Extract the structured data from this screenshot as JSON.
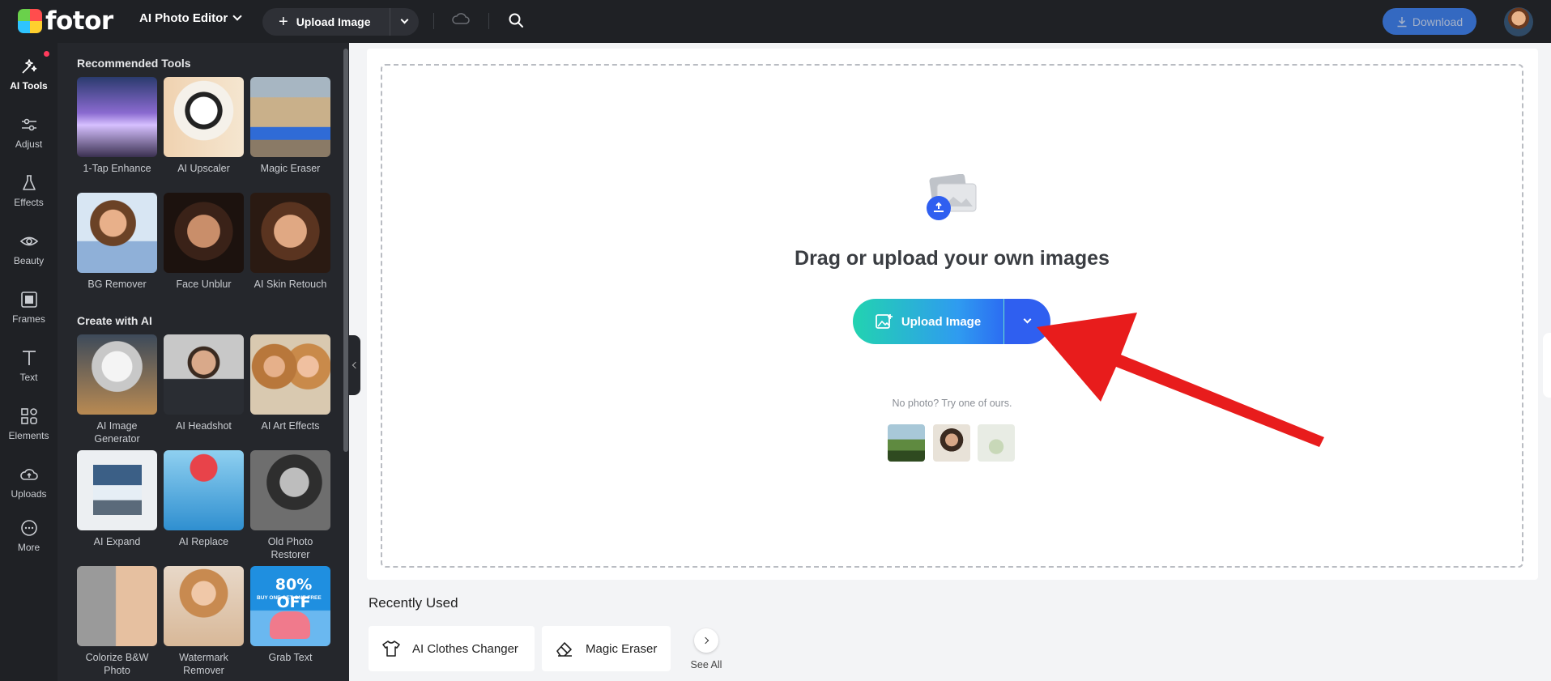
{
  "topbar": {
    "logo_text": "fotor",
    "editor_select": "AI Photo Editor",
    "upload_label": "Upload Image",
    "download_label": "Download"
  },
  "rail": {
    "items": [
      {
        "label": "AI Tools",
        "icon": "sparkle-icon"
      },
      {
        "label": "Adjust",
        "icon": "sliders-icon"
      },
      {
        "label": "Effects",
        "icon": "flask-icon"
      },
      {
        "label": "Beauty",
        "icon": "eye-icon"
      },
      {
        "label": "Frames",
        "icon": "frame-icon"
      },
      {
        "label": "Text",
        "icon": "text-icon"
      },
      {
        "label": "Elements",
        "icon": "shapes-icon"
      },
      {
        "label": "Uploads",
        "icon": "cloud-upload-icon"
      },
      {
        "label": "More",
        "icon": "more-icon"
      }
    ]
  },
  "panel": {
    "recommended_title": "Recommended Tools",
    "create_title": "Create with AI",
    "recommended": [
      {
        "label": "1-Tap Enhance"
      },
      {
        "label": "AI Upscaler"
      },
      {
        "label": "Magic Eraser"
      },
      {
        "label": "BG Remover"
      },
      {
        "label": "Face Unblur"
      },
      {
        "label": "AI Skin Retouch"
      }
    ],
    "create": [
      {
        "label": "AI Image Generator"
      },
      {
        "label": "AI Headshot"
      },
      {
        "label": "AI Art Effects"
      },
      {
        "label": "AI Expand"
      },
      {
        "label": "AI Replace"
      },
      {
        "label": "Old Photo Restorer"
      },
      {
        "label": "Colorize B&W Photo"
      },
      {
        "label": "Watermark Remover"
      },
      {
        "label": "Grab Text"
      }
    ],
    "promo_text": "80% OFF",
    "promo_sub": "BUY ONE GET ONE FREE"
  },
  "canvas": {
    "title": "Drag or upload your own images",
    "upload_label": "Upload Image",
    "no_photo": "No photo? Try one of ours."
  },
  "recent": {
    "title": "Recently Used",
    "items": [
      {
        "label": "AI Clothes Changer",
        "icon": "shirt-icon"
      },
      {
        "label": "Magic Eraser",
        "icon": "eraser-icon"
      }
    ],
    "see_all": "See All"
  }
}
